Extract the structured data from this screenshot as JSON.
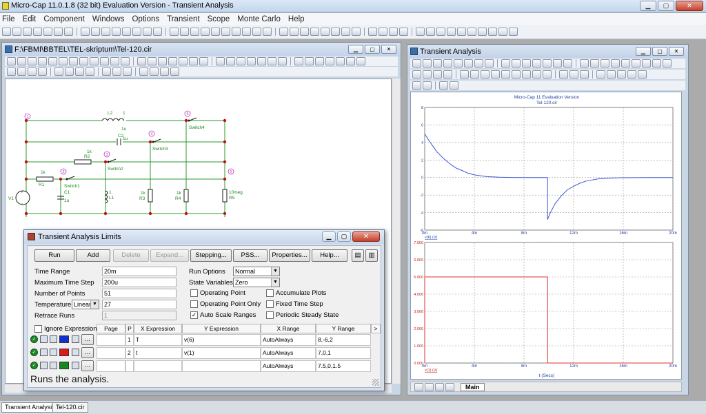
{
  "app": {
    "title": "Micro-Cap 11.0.1.8 (32 bit) Evaluation Version - Transient Analysis",
    "menu": [
      "File",
      "Edit",
      "Component",
      "Windows",
      "Options",
      "Transient",
      "Scope",
      "Monte Carlo",
      "Help"
    ]
  },
  "schematic_window": {
    "title": "F:\\FBMI\\BBTEL\\TEL-skriptum\\Tel-120.cir",
    "labels": {
      "node1": "1",
      "node2": "2",
      "node3": "3",
      "node4": "4",
      "node5": "5",
      "node6": "6",
      "L2": "L2",
      "L2_val": "1u",
      "L2_n": "1",
      "C2": "C2",
      "C2_val": "1u",
      "R2": "R2",
      "R2_val": "1k",
      "R1": "R1",
      "R1_val": "1k",
      "V1": "V1",
      "C1": "C1",
      "C1_val": "1u",
      "L1": "L1",
      "L1_val": "1",
      "R3": "R3",
      "R3_val": "1k",
      "R4": "R4",
      "R4_val": "1k",
      "R5": "R5",
      "R5_val": "10meg",
      "sw1": "Switch1",
      "sw2": "Switch2",
      "sw3": "Switch3",
      "sw4": "Switch4",
      "plus": "+",
      "minus": "-"
    }
  },
  "analysis_window": {
    "title": "Transient Analysis",
    "plot_title": "Micro-Cap 11 Evaluation Version",
    "plot_subtitle": "Tel-120.cir",
    "tab": "Main",
    "xlabel": "t (Secs)"
  },
  "chart_data": [
    {
      "type": "line",
      "title": "Micro-Cap 11 Evaluation Version",
      "subtitle": "Tel-120.cir",
      "xlabel": "",
      "ylabel": "v(6) (V)",
      "x_ticks": [
        "0m",
        "4m",
        "8m",
        "12m",
        "16m",
        "20m"
      ],
      "y_ticks": [
        "8",
        "6",
        "4",
        "2",
        "0",
        "-2",
        "-4",
        "-6"
      ],
      "xlim": [
        0,
        20
      ],
      "ylim": [
        -6,
        8
      ],
      "grid": true,
      "series": [
        {
          "name": "v(6) (V)",
          "color": "#3a56d8",
          "x": [
            0,
            0.3,
            0.7,
            1,
            1.5,
            2,
            2.5,
            3,
            3.5,
            4,
            5,
            6,
            7,
            8,
            9.9,
            9.9,
            10.1,
            10.5,
            11,
            11.5,
            12,
            12.5,
            13,
            14,
            15,
            16,
            18,
            20
          ],
          "y": [
            5,
            4.3,
            3.5,
            2.9,
            2.2,
            1.6,
            1.1,
            0.8,
            0.5,
            0.3,
            0.1,
            0.03,
            0.01,
            0,
            0,
            -4.8,
            -4.1,
            -3,
            -2.1,
            -1.4,
            -1,
            -0.65,
            -0.4,
            -0.15,
            -0.06,
            -0.02,
            0,
            0
          ]
        }
      ]
    },
    {
      "type": "line",
      "xlabel": "t (Secs)",
      "ylabel": "v(1) (V)",
      "x_ticks": [
        "0m",
        "4m",
        "8m",
        "12m",
        "16m",
        "20m"
      ],
      "y_ticks": [
        "7.000",
        "6.000",
        "5.000",
        "4.000",
        "3.000",
        "2.000",
        "1.000",
        "0.000"
      ],
      "xlim": [
        0,
        20
      ],
      "ylim": [
        0,
        7
      ],
      "grid": true,
      "series": [
        {
          "name": "v(1) (V)",
          "color": "#e23030",
          "x": [
            0,
            0,
            9.9,
            9.9,
            20
          ],
          "y": [
            0,
            5,
            5,
            0,
            0
          ]
        }
      ]
    }
  ],
  "dialog": {
    "title": "Transient Analysis Limits",
    "buttons": {
      "run": "Run",
      "add": "Add",
      "delete": "Delete",
      "expand": "Expand...",
      "stepping": "Stepping...",
      "pss": "PSS...",
      "properties": "Properties...",
      "help": "Help..."
    },
    "fields": {
      "time_range_label": "Time Range",
      "time_range": "20m",
      "max_step_label": "Maximum Time Step",
      "max_step": "200u",
      "points_label": "Number of Points",
      "points": "51",
      "temp_label": "Temperature",
      "temp_mode": "Linear",
      "temp": "27",
      "retrace_label": "Retrace Runs",
      "retrace": "1",
      "run_options_label": "Run Options",
      "run_options": "Normal",
      "state_label": "State Variables",
      "state": "Zero"
    },
    "checks": {
      "op_point": "Operating Point",
      "op_only": "Operating Point Only",
      "auto_scale": "Auto Scale Ranges",
      "accumulate": "Accumulate Plots",
      "fixed_step": "Fixed Time Step",
      "periodic": "Periodic Steady State",
      "ignore_expr": "Ignore Expression Errors"
    },
    "columns": [
      "Page",
      "P",
      "X Expression",
      "Y Expression",
      "X Range",
      "Y Range",
      ">"
    ],
    "rows": [
      {
        "page": "",
        "p": "1",
        "xexpr": "T",
        "yexpr": "v(6)",
        "xrange": "AutoAlways",
        "yrange": "8,-6,2",
        "color": "#1030d0"
      },
      {
        "page": "",
        "p": "2",
        "xexpr": "t",
        "yexpr": "v(1)",
        "xrange": "AutoAlways",
        "yrange": "7,0,1",
        "color": "#e01818"
      },
      {
        "page": "",
        "p": "",
        "xexpr": "",
        "yexpr": "",
        "xrange": "AutoAlways",
        "yrange": "7.5,0,1.5",
        "color": "#128a20"
      }
    ],
    "more_btn": "...",
    "status": "Runs the analysis."
  },
  "bottom_tabs": [
    "Transient Analysis",
    "Tel-120.cir"
  ]
}
